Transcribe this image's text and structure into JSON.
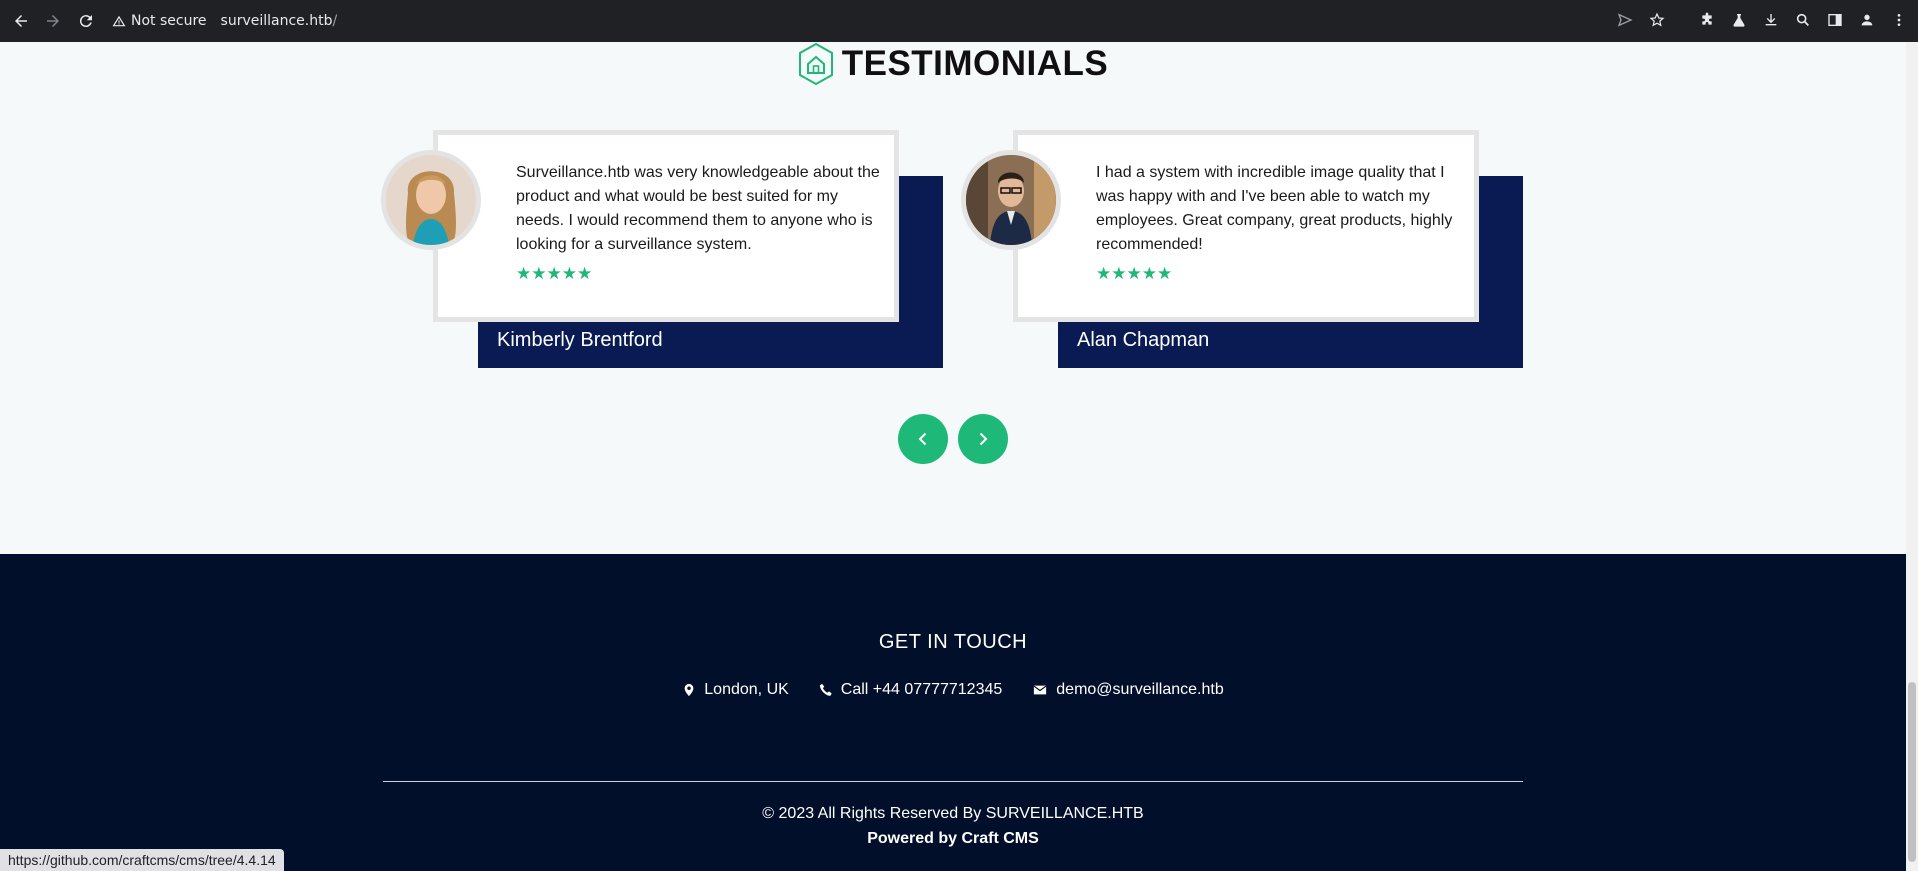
{
  "browser": {
    "security_label": "Not secure",
    "url_host": "surveillance.htb",
    "url_path": "/"
  },
  "testimonials": {
    "title": "TESTIMONIALS",
    "items": [
      {
        "text": "Surveillance.htb was very knowledgeable about the product and what would be best suited for my needs. I would recommend them to anyone who is looking for a surveillance system.",
        "name": "Kimberly Brentford",
        "stars": "★★★★★"
      },
      {
        "text": "I had a system with incredible image quality that I was happy with and I've been able to watch my employees. Great company, great products, highly recommended!",
        "name": "Alan Chapman",
        "stars": "★★★★★"
      }
    ]
  },
  "footer": {
    "heading": "GET IN TOUCH",
    "location": "London, UK",
    "phone": "Call +44 07777712345",
    "email": "demo@surveillance.htb",
    "copyright": "© 2023 All Rights Reserved By SURVEILLANCE.HTB",
    "powered_by": "Powered by Craft CMS"
  },
  "status_bar": {
    "link": "https://github.com/craftcms/cms/tree/4.4.14"
  },
  "colors": {
    "accent": "#1eb878",
    "navy": "#0a1a52",
    "footer_bg": "#020f2b"
  }
}
